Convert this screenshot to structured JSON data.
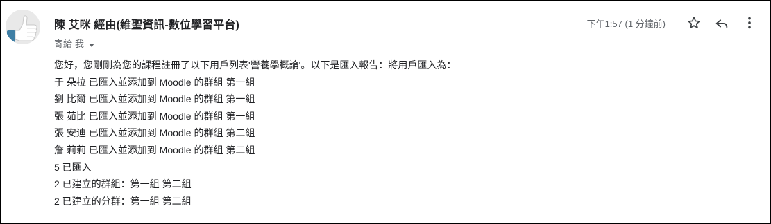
{
  "email": {
    "sender": "陳 艾咪 經由(維聖資訊-數位學習平台)",
    "recipient_label": "寄給",
    "recipient": "我",
    "timestamp": "下午1:57 (1 分鐘前)",
    "body_lines": [
      "您好，您剛剛為您的課程註冊了以下用戶列表'營養學概論'。以下是匯入報告：將用戶匯入為：",
      "于 朵拉 已匯入並添加到 Moodle 的群組 第一組",
      "劉 比爾 已匯入並添加到 Moodle 的群組 第一組",
      "張 茹比 已匯入並添加到 Moodle 的群組 第一組",
      "張 安迪 已匯入並添加到 Moodle 的群組 第二組",
      "詹 莉莉 已匯入並添加到 Moodle 的群組 第二組",
      "5 已匯入",
      "2 已建立的群組：第一組 第二組",
      "2 已建立的分群：第一組 第二組"
    ]
  },
  "icons": {
    "avatar": "thumbs-up-avatar",
    "dropdown": "caret-down-icon",
    "star": "star-icon",
    "reply": "reply-icon",
    "more": "more-vert-icon"
  },
  "colors": {
    "text_primary": "#202124",
    "text_secondary": "#5f6368",
    "border": "#000000",
    "avatar_bg": "#e9e9e9",
    "thumb": "#3f7fa5"
  }
}
